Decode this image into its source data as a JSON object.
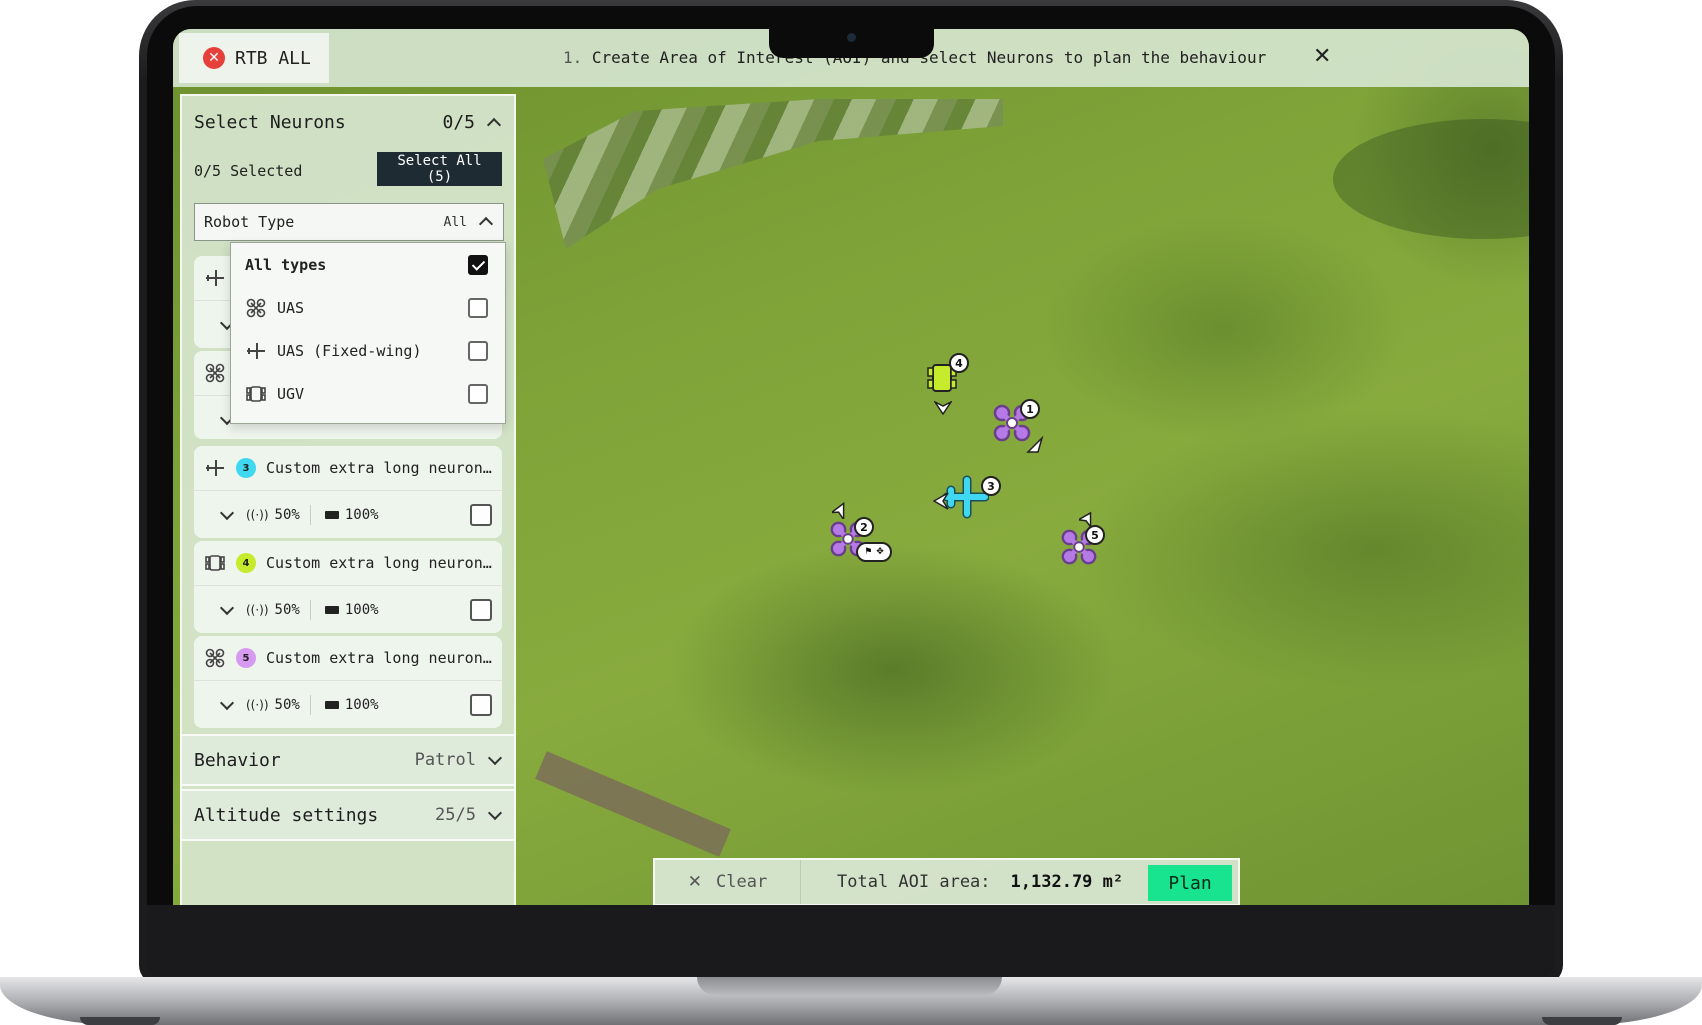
{
  "topbar": {
    "rtb_label": "RTB ALL",
    "instruction_num": "1.",
    "instruction_text": "Create Area of Interest (AOI) and select Neurons to plan the behaviour"
  },
  "panel": {
    "title": "Select Neurons",
    "count": "0/5",
    "selected_text": "0/5 Selected",
    "select_all_label": "Select All (5)",
    "robot_type_label": "Robot Type",
    "robot_type_value": "All",
    "dropdown": [
      {
        "label": "All types",
        "icon": "none",
        "checked": true
      },
      {
        "label": "UAS",
        "icon": "quadcopter-icon",
        "checked": false
      },
      {
        "label": "UAS (Fixed-wing)",
        "icon": "fixed-wing-icon",
        "checked": false
      },
      {
        "label": "UGV",
        "icon": "ugv-icon",
        "checked": false
      }
    ],
    "neurons": [
      {
        "id": "3",
        "name": "Custom extra long neuron…",
        "type": "fixed-wing",
        "badge_color": "#3fd8f0",
        "signal": "50%",
        "battery": "100%"
      },
      {
        "id": "4",
        "name": "Custom extra long neuron…",
        "type": "ugv",
        "badge_color": "#c6ea2c",
        "signal": "50%",
        "battery": "100%"
      },
      {
        "id": "5",
        "name": "Custom extra long neuron…",
        "type": "quadcopter",
        "badge_color": "#d69af0",
        "signal": "50%",
        "battery": "100%"
      }
    ],
    "behavior_label": "Behavior",
    "behavior_value": "Patrol",
    "altitude_label": "Altitude settings",
    "altitude_value": "25/5"
  },
  "bottombar": {
    "clear_label": "Clear",
    "aoi_label": "Total AOI area:",
    "aoi_value": "1,132.79 m²",
    "plan_label": "Plan"
  },
  "map_markers": [
    {
      "id": "1",
      "type": "quadcopter",
      "color": "#b57ae6"
    },
    {
      "id": "2",
      "type": "quadcopter",
      "color": "#b57ae6"
    },
    {
      "id": "3",
      "type": "fixed-wing",
      "color": "#3fd8f0"
    },
    {
      "id": "4",
      "type": "ugv",
      "color": "#c6ea2c"
    },
    {
      "id": "5",
      "type": "quadcopter",
      "color": "#b57ae6"
    }
  ],
  "colors": {
    "accent": "#18e38e",
    "rtb_red": "#e5413a",
    "dark_button": "#1f2b33"
  }
}
